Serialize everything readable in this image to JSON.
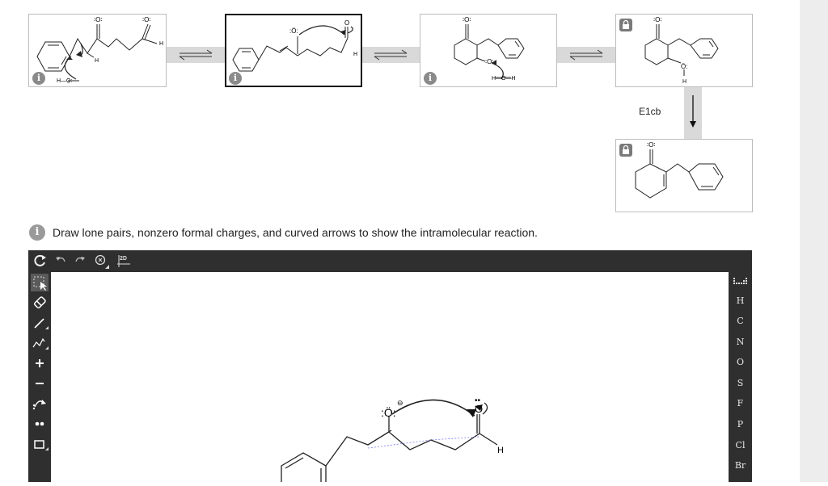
{
  "mechanism": {
    "steps": [
      {
        "id": "step1",
        "atoms": {
          "o1": "∶O∶",
          "o2": "∶O∶",
          "h_ald": "H",
          "h_alpha": "H",
          "hydroxide": "H—O̤:"
        },
        "locked": false,
        "selected": false
      },
      {
        "id": "step2",
        "atoms": {
          "o_enolate": ":Ö:",
          "o_ald": "O",
          "h_ald": "H"
        },
        "locked": false,
        "selected": true
      },
      {
        "id": "step3",
        "atoms": {
          "o_ketone": "∶O∶",
          "o_alkoxide": "∶O∶",
          "water": "H—O—H"
        },
        "locked": false,
        "selected": false
      },
      {
        "id": "step4",
        "atoms": {
          "o_ketone": "∶O∶",
          "o_hydroxyl": "Ö:",
          "h": "H"
        },
        "locked": true,
        "selected": false
      },
      {
        "id": "step5",
        "atoms": {
          "o_ketone": "∶O∶"
        },
        "locked": true,
        "selected": false
      }
    ],
    "arrow_label": "E1cb",
    "info_icon": "i"
  },
  "instruction": {
    "text": "Draw lone pairs, nonzero formal charges, and curved arrows to show the intramolecular reaction."
  },
  "editor": {
    "top_tools": [
      {
        "name": "reset-icon",
        "glyph": "↻"
      },
      {
        "name": "undo-icon",
        "glyph": "↶"
      },
      {
        "name": "redo-icon",
        "glyph": "↷"
      },
      {
        "name": "zoom-icon",
        "glyph": "⊗"
      },
      {
        "name": "clean-2d-icon",
        "glyph": "2D"
      }
    ],
    "left_tools": [
      {
        "name": "select-tool-icon",
        "glyph": "⬚",
        "active": true
      },
      {
        "name": "eraser-icon",
        "glyph": "⊘"
      },
      {
        "name": "bond-tool-icon",
        "glyph": "╱"
      },
      {
        "name": "chain-tool-icon",
        "glyph": "⌇"
      },
      {
        "name": "positive-charge-icon",
        "glyph": "+"
      },
      {
        "name": "negative-charge-icon",
        "glyph": "−"
      },
      {
        "name": "curved-arrow-icon",
        "glyph": "⤴"
      },
      {
        "name": "lone-pair-icon",
        "glyph": "••"
      },
      {
        "name": "ring-tool-icon",
        "glyph": "□"
      }
    ],
    "elements": [
      "H",
      "C",
      "N",
      "O",
      "S",
      "F",
      "P",
      "Cl",
      "Br"
    ],
    "canvas_atoms": {
      "o_enolate": ":Ö:",
      "o_ald": "O",
      "h": "H",
      "charge": "⊖",
      "lp": "••"
    }
  }
}
